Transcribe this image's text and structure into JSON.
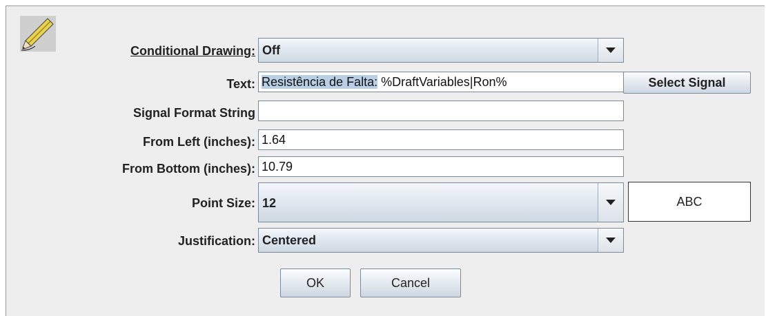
{
  "form": {
    "conditional_drawing": {
      "label": "Conditional Drawing:",
      "value": "Off"
    },
    "text": {
      "label": "Text:",
      "value_selected": "Resistência de Falta:",
      "value_rest": " %DraftVariables|Ron%",
      "button": "Select Signal"
    },
    "signal_format": {
      "label": "Signal Format String",
      "value": ""
    },
    "from_left": {
      "label": "From Left (inches):",
      "value": "1.64"
    },
    "from_bottom": {
      "label": "From Bottom (inches):",
      "value": "10.79"
    },
    "point_size": {
      "label": "Point Size:",
      "value": "12",
      "preview": "ABC"
    },
    "justification": {
      "label": "Justification:",
      "value": "Centered"
    }
  },
  "buttons": {
    "ok": "OK",
    "cancel": "Cancel"
  },
  "icons": {
    "header": "pencil-icon"
  }
}
